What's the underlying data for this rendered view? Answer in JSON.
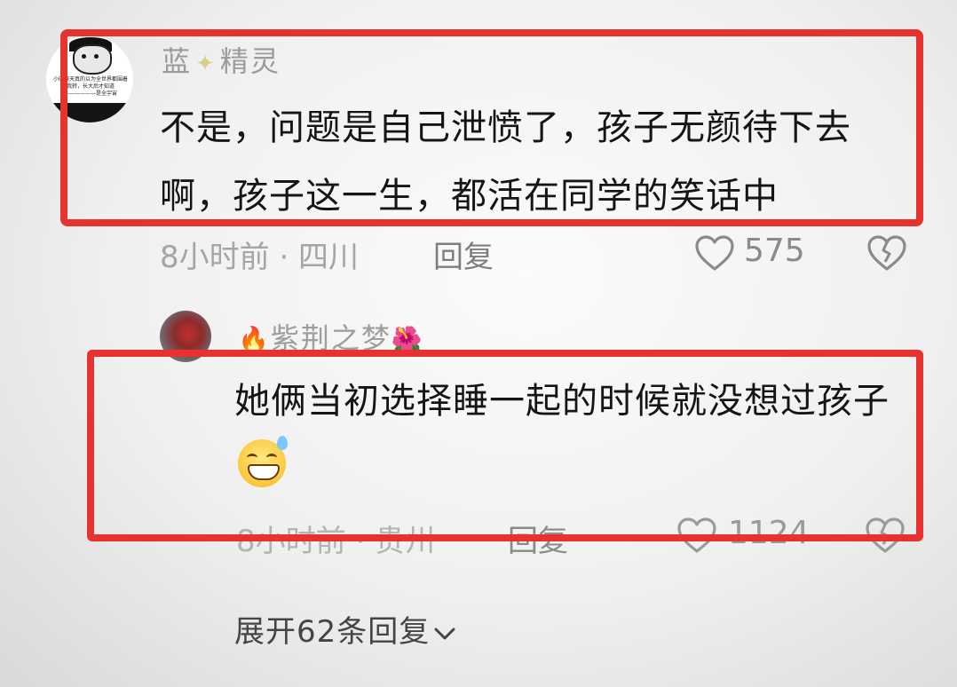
{
  "comments": [
    {
      "user": "蓝",
      "user_suffix": "精灵",
      "name_decoration": "✦",
      "avatar_text": "小时候天真的以为全世界都围着我转，长大后才知道——————是全宇宙",
      "text": "不是，问题是自己泄愤了，孩子无颜待下去啊，孩子这一生，都活在同学的笑话中",
      "time_location": "8小时前 · 四川",
      "reply_label": "回复",
      "likes": "575",
      "highlighted": true
    },
    {
      "user": "紫荆之梦",
      "user_prefix_icon": "flame-icon",
      "user_suffix_icon": "hibiscus-icon",
      "text": "她俩当初选择睡一起的时候就没想过孩子",
      "emoji": "grinning-sweat-emoji",
      "time_location": "8小时前 · 贵州",
      "reply_label": "回复",
      "likes": "1124",
      "highlighted": true
    }
  ],
  "expand_replies_label": "展开62条回复",
  "colors": {
    "highlight_box": "#e8322f",
    "text": "#151515",
    "meta": "#a5a5a5"
  }
}
